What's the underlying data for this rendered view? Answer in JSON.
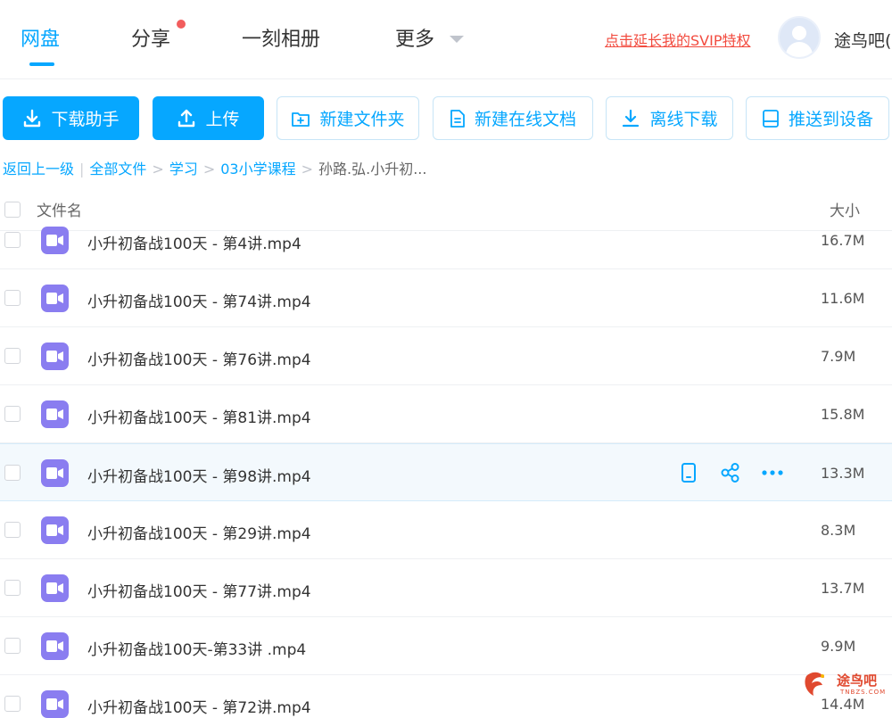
{
  "nav": {
    "tabs": [
      {
        "label": "网盘"
      },
      {
        "label": "分享"
      },
      {
        "label": "一刻相册"
      },
      {
        "label": "更多"
      }
    ],
    "svip_link": "点击延长我的SVIP特权",
    "username": "途鸟吧("
  },
  "toolbar": {
    "download_helper": "下载助手",
    "upload": "上传",
    "new_folder": "新建文件夹",
    "new_online_doc": "新建在线文档",
    "offline_download": "离线下载",
    "push_to_device": "推送到设备"
  },
  "breadcrumb": {
    "back": "返回上一级",
    "items": [
      "全部文件",
      "学习",
      "03小学课程"
    ],
    "current": "孙路.弘.小升初..."
  },
  "table": {
    "col_name": "文件名",
    "col_size": "大小",
    "rows": [
      {
        "name": "小升初备战100天 - 第4讲.mp4",
        "size": "16.7M"
      },
      {
        "name": "小升初备战100天 - 第74讲.mp4",
        "size": "11.6M"
      },
      {
        "name": "小升初备战100天 - 第76讲.mp4",
        "size": "7.9M"
      },
      {
        "name": "小升初备战100天 - 第81讲.mp4",
        "size": "15.8M"
      },
      {
        "name": "小升初备战100天 - 第98讲.mp4",
        "size": "13.3M"
      },
      {
        "name": "小升初备战100天 - 第29讲.mp4",
        "size": "8.3M"
      },
      {
        "name": "小升初备战100天 - 第77讲.mp4",
        "size": "13.7M"
      },
      {
        "name": "小升初备战100天-第33讲 .mp4",
        "size": "9.9M"
      },
      {
        "name": "小升初备战100天 - 第72讲.mp4",
        "size": "14.4M"
      }
    ]
  },
  "watermark": {
    "text": "途鸟吧",
    "sub": "TNBZS.COM"
  },
  "colors": {
    "accent": "#06a7ff",
    "svip": "#f24b3f",
    "video_icon": "#8a7df0",
    "hover_row": "#f3f9fd"
  }
}
